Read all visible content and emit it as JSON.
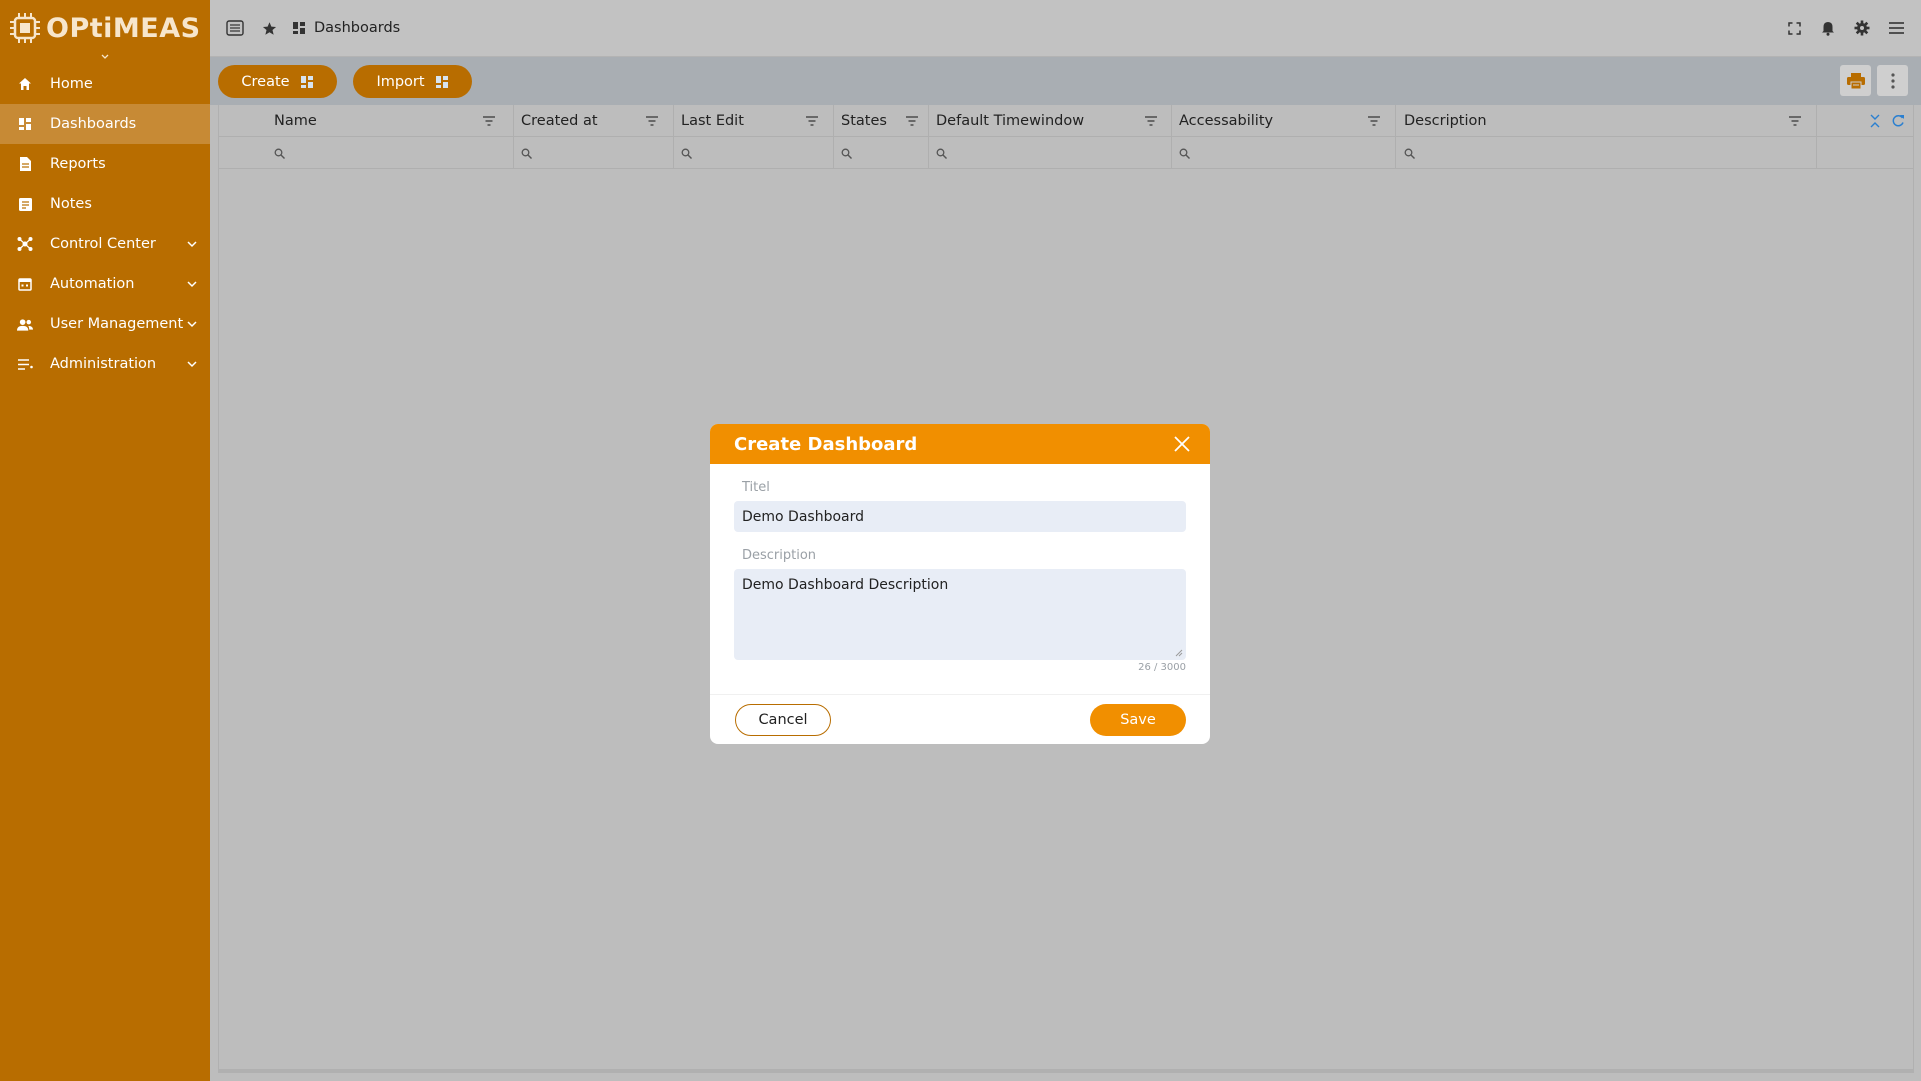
{
  "app": {
    "logo_text": "OPtiMEAS"
  },
  "sidebar": {
    "items": [
      {
        "label": "Home",
        "icon": "home-icon"
      },
      {
        "label": "Dashboards",
        "icon": "dashboard-icon",
        "active": true
      },
      {
        "label": "Reports",
        "icon": "report-icon"
      },
      {
        "label": "Notes",
        "icon": "note-icon"
      },
      {
        "label": "Control Center",
        "icon": "hub-icon",
        "expandable": true
      },
      {
        "label": "Automation",
        "icon": "calendar-icon",
        "expandable": true
      },
      {
        "label": "User Management",
        "icon": "users-icon",
        "expandable": true
      },
      {
        "label": "Administration",
        "icon": "list-icon",
        "expandable": true
      }
    ]
  },
  "topbar": {
    "breadcrumb": "Dashboards"
  },
  "toolbar": {
    "create_label": "Create",
    "import_label": "Import"
  },
  "grid": {
    "columns": [
      "Name",
      "Created at",
      "Last Edit",
      "States",
      "Default Timewindow",
      "Accessability",
      "Description"
    ]
  },
  "dialog": {
    "title": "Create Dashboard",
    "title_label": "Titel",
    "title_value": "Demo Dashboard",
    "description_label": "Description",
    "description_value": "Demo Dashboard Description",
    "counter": "26 / 3000",
    "cancel_label": "Cancel",
    "save_label": "Save"
  },
  "colors": {
    "sidebar": "#b86d00",
    "accent": "#f18f00",
    "overlay": "#bdbdbd"
  }
}
